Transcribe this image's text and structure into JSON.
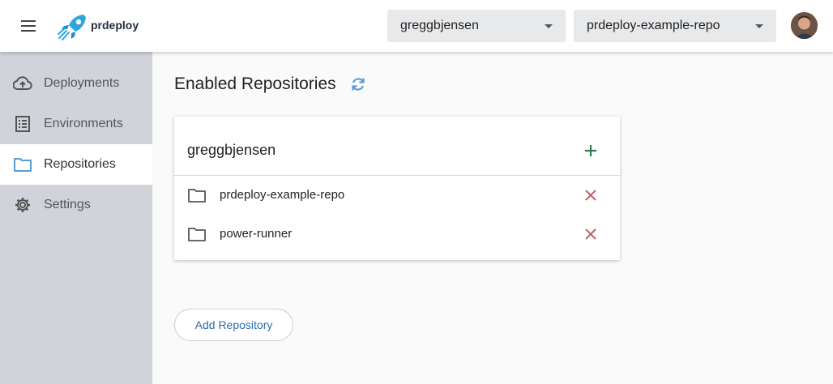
{
  "header": {
    "brand": "prdeploy",
    "org_select": {
      "value": "greggbjensen"
    },
    "repo_select": {
      "value": "prdeploy-example-repo"
    },
    "logo_icon": "rocket-icon",
    "menu_icon": "hamburger-icon",
    "avatar_icon": "user-avatar"
  },
  "sidebar": {
    "items": [
      {
        "label": "Deployments",
        "icon": "cloud-upload-icon",
        "active": false
      },
      {
        "label": "Environments",
        "icon": "list-icon",
        "active": false
      },
      {
        "label": "Repositories",
        "icon": "folder-icon",
        "active": true
      },
      {
        "label": "Settings",
        "icon": "gear-icon",
        "active": false
      }
    ]
  },
  "main": {
    "title": "Enabled Repositories",
    "refresh_icon": "refresh-icon",
    "card": {
      "title": "greggbjensen",
      "add_icon": "plus-icon",
      "repositories": [
        {
          "name": "prdeploy-example-repo",
          "icon": "folder-icon",
          "remove_icon": "close-icon"
        },
        {
          "name": "power-runner",
          "icon": "folder-icon",
          "remove_icon": "close-icon"
        }
      ]
    },
    "add_button_label": "Add Repository"
  },
  "colors": {
    "sidebar_bg": "#d0d3d9",
    "accent_blue": "#5b9bd5",
    "add_green": "#2e7d4f",
    "remove_red": "#c0616a",
    "button_text": "#2e6ea8"
  }
}
